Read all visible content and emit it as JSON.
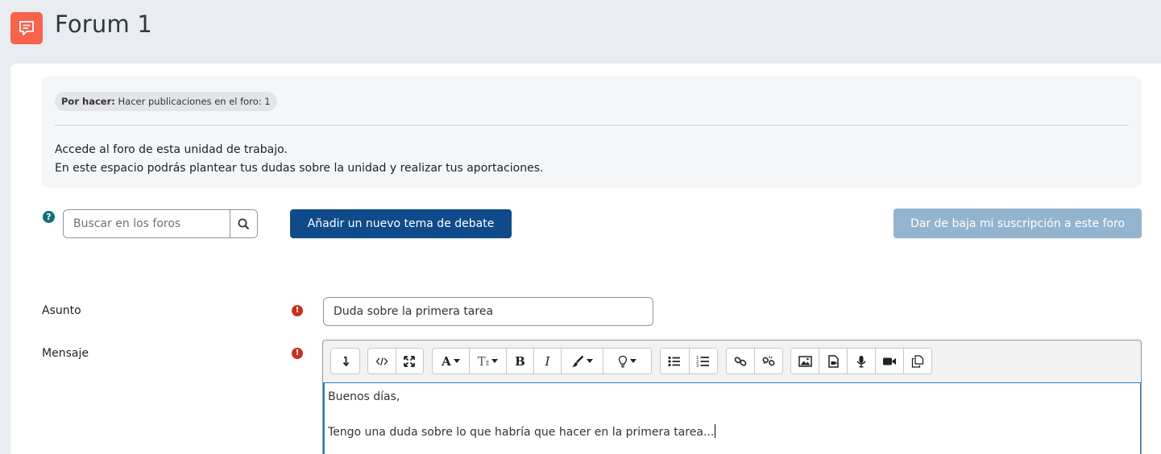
{
  "header": {
    "title": "Forum 1",
    "icon": "forum-icon"
  },
  "completion": {
    "label": "Por hacer:",
    "text": "Hacer publicaciones en el foro: 1"
  },
  "intro": {
    "line1": "Accede al foro de esta unidad de trabajo.",
    "line2": "En este espacio podrás plantear tus dudas sobre la unidad y realizar tus aportaciones."
  },
  "search": {
    "placeholder": "Buscar en los foros",
    "value": ""
  },
  "actions": {
    "add_topic": "Añadir un nuevo tema de debate",
    "unsubscribe": "Dar de baja mi suscripción a este foro"
  },
  "form": {
    "subject_label": "Asunto",
    "subject_value": "Duda sobre la primera tarea",
    "message_label": "Mensaje",
    "message_lines": [
      "Buenos días,",
      "",
      "Tengo una duda sobre lo que habría que hacer en la primera tarea..."
    ]
  },
  "colors": {
    "accent": "#0f4b8a",
    "forum_icon": "#f7634d",
    "required": "#ca3120",
    "disabled_button": "#93b4cf"
  }
}
